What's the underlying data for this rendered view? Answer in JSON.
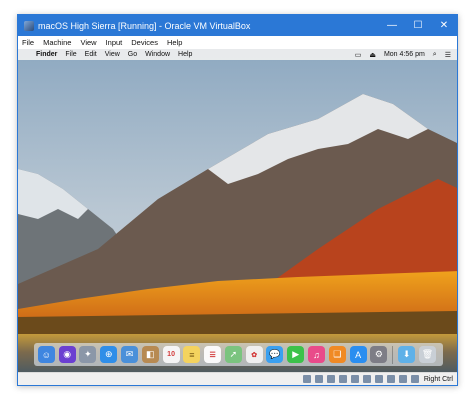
{
  "window": {
    "title": "macOS High Sierra [Running] - Oracle VM VirtualBox",
    "controls": {
      "minimize": "—",
      "maximize": "☐",
      "close": "✕"
    }
  },
  "vbox_menu": [
    "File",
    "Machine",
    "View",
    "Input",
    "Devices",
    "Help"
  ],
  "mac_menubar": {
    "apple": "",
    "app_name": "Finder",
    "items": [
      "File",
      "Edit",
      "View",
      "Go",
      "Window",
      "Help"
    ],
    "clock": "Mon 4:56 pm"
  },
  "dock": {
    "apps": [
      {
        "name": "finder-icon",
        "color": "#3f86e0",
        "glyph": "☺"
      },
      {
        "name": "siri-icon",
        "color": "#6b3fd1",
        "glyph": "◉"
      },
      {
        "name": "launchpad-icon",
        "color": "#8b97a8",
        "glyph": "✦"
      },
      {
        "name": "safari-icon",
        "color": "#2f8ee8",
        "glyph": "⊕"
      },
      {
        "name": "mail-icon",
        "color": "#4a90d9",
        "glyph": "✉"
      },
      {
        "name": "contacts-icon",
        "color": "#b78a52",
        "glyph": "◧"
      },
      {
        "name": "calendar-icon",
        "color": "#f5f5f5",
        "glyph": "10"
      },
      {
        "name": "notes-icon",
        "color": "#f4d35e",
        "glyph": "≡"
      },
      {
        "name": "reminders-icon",
        "color": "#fafafa",
        "glyph": "☰"
      },
      {
        "name": "maps-icon",
        "color": "#7bc47f",
        "glyph": "➚"
      },
      {
        "name": "photos-icon",
        "color": "#f0f0f0",
        "glyph": "✿"
      },
      {
        "name": "messages-icon",
        "color": "#3aa0f0",
        "glyph": "💬"
      },
      {
        "name": "facetime-icon",
        "color": "#3cc24a",
        "glyph": "▶"
      },
      {
        "name": "itunes-icon",
        "color": "#e94b8a",
        "glyph": "♫"
      },
      {
        "name": "ibooks-icon",
        "color": "#f08a24",
        "glyph": "❑"
      },
      {
        "name": "app-store-icon",
        "color": "#2a8ef0",
        "glyph": "A"
      },
      {
        "name": "system-preferences-icon",
        "color": "#7d7d86",
        "glyph": "⚙"
      }
    ],
    "trailing": [
      {
        "name": "downloads-folder-icon",
        "color": "#5fb1e8",
        "glyph": "⬇"
      },
      {
        "name": "trash-icon",
        "color": "#c9cfd6",
        "glyph": "🗑"
      }
    ]
  },
  "statusbar": {
    "host_key": "Right Ctrl",
    "icons": [
      "hard-disk-icon",
      "optical-drive-icon",
      "audio-icon",
      "network-icon",
      "usb-icon",
      "shared-folder-icon",
      "display-icon",
      "video-capture-icon",
      "cpu-icon",
      "mouse-integration-icon"
    ]
  }
}
